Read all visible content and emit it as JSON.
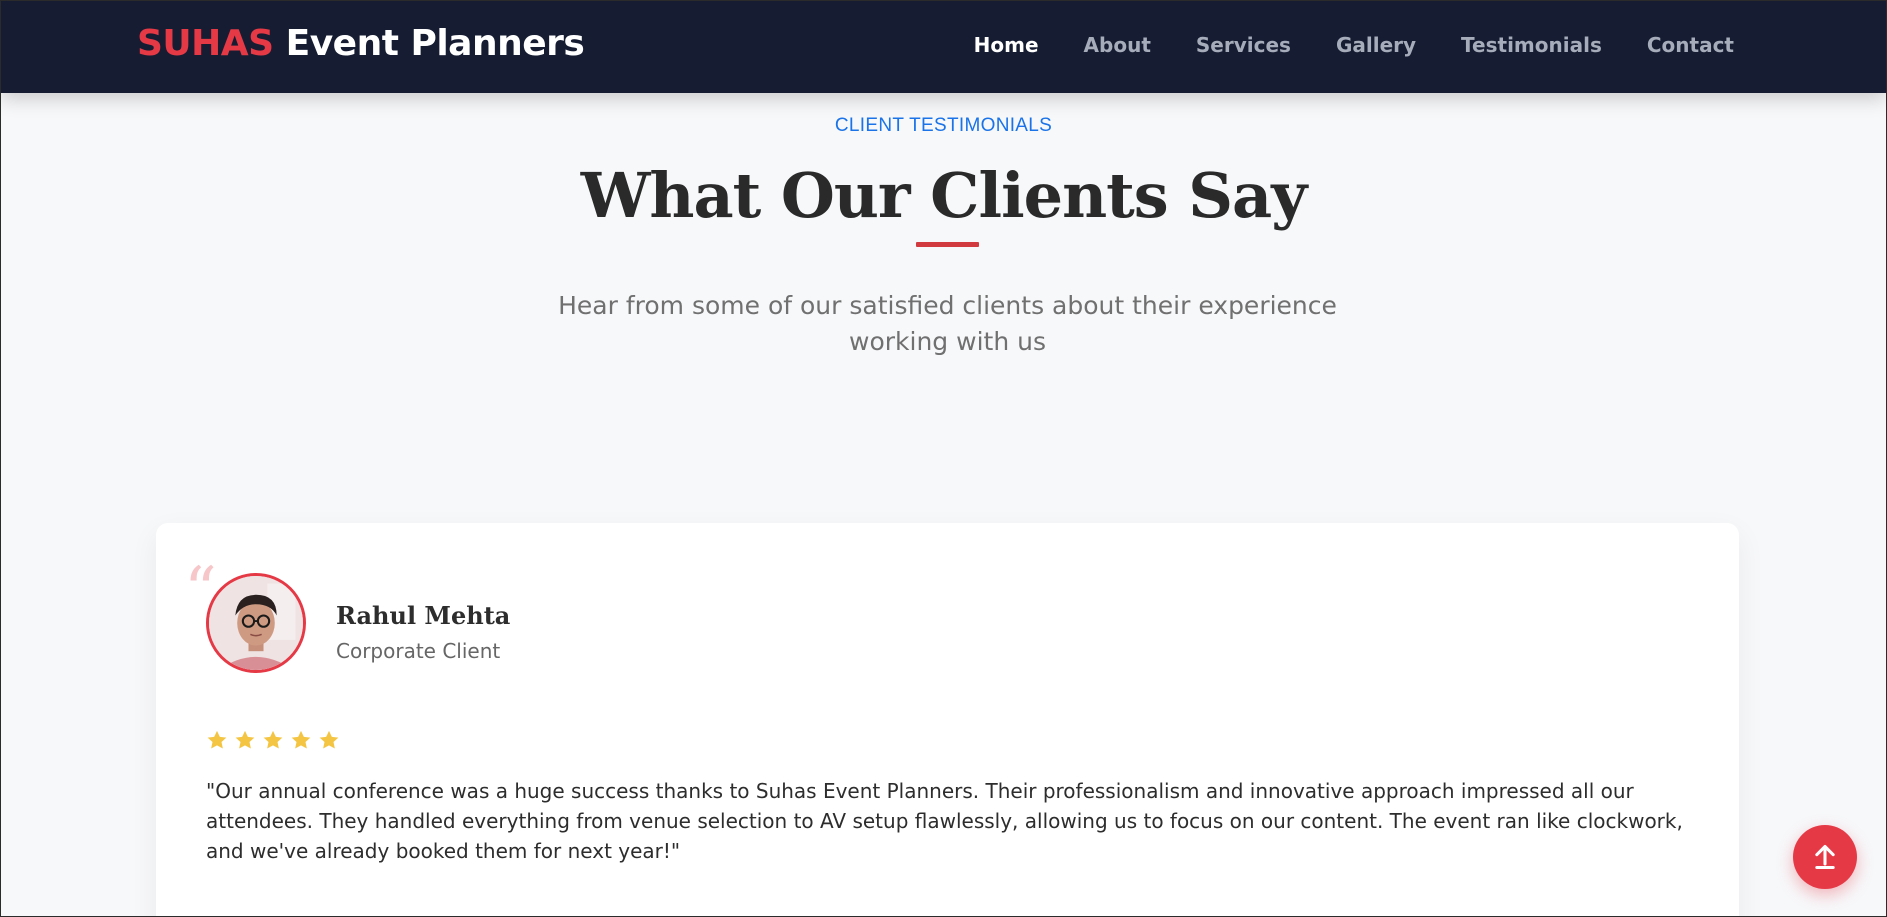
{
  "header": {
    "logo_brand": "SUHAS",
    "logo_rest": " Event Planners",
    "nav": [
      {
        "label": "Home",
        "active": true
      },
      {
        "label": "About",
        "active": false
      },
      {
        "label": "Services",
        "active": false
      },
      {
        "label": "Gallery",
        "active": false
      },
      {
        "label": "Testimonials",
        "active": false
      },
      {
        "label": "Contact",
        "active": false
      }
    ]
  },
  "section": {
    "eyebrow": "CLIENT TESTIMONIALS",
    "title": "What Our Clients Say",
    "subtitle": "Hear from some of our satisfied clients about their experience working with us"
  },
  "testimonial": {
    "name": "Rahul Mehta",
    "role": "Corporate Client",
    "rating": 5,
    "max_rating": 5,
    "quote_mark": "“",
    "text": "\"Our annual conference was a huge success thanks to Suhas Event Planners. Their professionalism and innovative approach impressed all our attendees. They handled everything from venue selection to AV setup flawlessly, allowing us to focus on our content. The event ran like clockwork, and we've already booked them for next year!\""
  },
  "colors": {
    "accent": "#e63946",
    "header_bg": "#161d33",
    "eyebrow": "#1a73e8",
    "star": "#f4c542"
  },
  "icons": {
    "back_to_top": "arrow-up-icon",
    "rating": "star-icon"
  }
}
